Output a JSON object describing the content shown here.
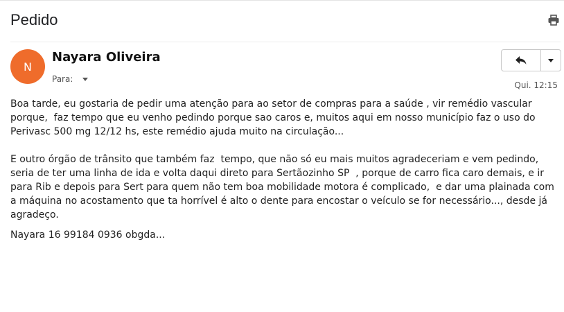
{
  "email": {
    "subject": "Pedido",
    "sender_name": "Nayara Oliveira",
    "avatar_initial": "N",
    "to_label": "Para:",
    "date": "Qui. 12:15",
    "body_paragraphs": [
      "Boa tarde, eu gostaria de pedir uma atenção para ao setor de compras para a saúde , vir remédio vascular porque,  faz tempo que eu venho pedindo porque sao caros e, muitos aqui em nosso município faz o uso do Perivasc 500 mg 12/12 hs, este remédio ajuda muito na circulação...",
      "E outro órgão de trânsito que também faz  tempo, que não só eu mais muitos agradeceriam e vem pedindo,  seria de ter uma linha de ida e volta daqui direto para Sertãozinho SP  , porque de carro fica caro demais, e ir para Rib e depois para Sert para quem não tem boa mobilidade motora é complicado,  e dar uma plainada com a máquina no acostamento que ta horrível é alto o dente para encostar o veículo se for necessário..., desde já agradeço."
    ],
    "signature": "Nayara 16 99184 0936 obgda..."
  },
  "icons": {
    "print": "print-icon",
    "reply": "reply-icon",
    "more": "chevron-down-icon"
  },
  "colors": {
    "avatar_bg": "#ef6c2b"
  }
}
